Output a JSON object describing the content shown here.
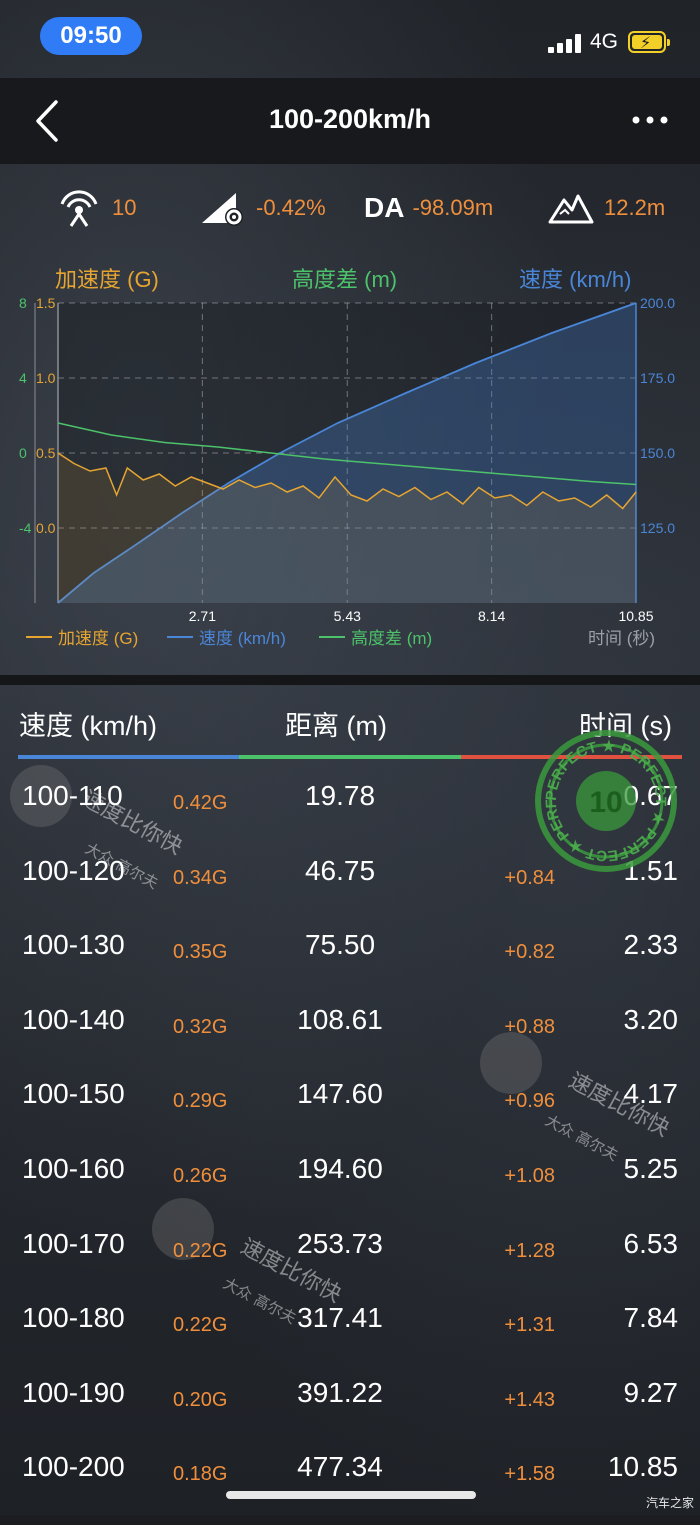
{
  "status_bar": {
    "time": "09:50",
    "network": "4G"
  },
  "nav": {
    "title": "100-200km/h"
  },
  "stats": {
    "satellites": "10",
    "slope": "-0.42%",
    "da_label": "DA",
    "da_value": "-98.09m",
    "altitude": "12.2m"
  },
  "chart_titles": {
    "accel": "加速度 (G)",
    "height": "高度差 (m)",
    "speed": "速度 (km/h)"
  },
  "legend": {
    "accel": "加速度 (G)",
    "speed": "速度 (km/h)",
    "height": "高度差 (m)",
    "time_axis": "时间 (秒)"
  },
  "chart_data": {
    "type": "line",
    "x_ticks": [
      "2.71",
      "5.43",
      "8.14",
      "10.85"
    ],
    "xlim": [
      0,
      10.85
    ],
    "left_ticks_height": [
      "8",
      "4",
      "0",
      "-4"
    ],
    "left_ticks_accel": [
      "1.5",
      "1.0",
      "0.5",
      "0.0"
    ],
    "right_ticks_speed": [
      "200.0",
      "175.0",
      "150.0",
      "125.0"
    ],
    "speed_ylim": [
      100,
      200
    ],
    "accel_ylim": [
      -0.5,
      1.5
    ],
    "height_ylim": [
      -12,
      8
    ],
    "series": [
      {
        "name": "速度 (km/h)",
        "axis": "right",
        "color": "#4a86d8",
        "x": [
          0,
          0.67,
          1.51,
          2.33,
          3.2,
          4.17,
          5.25,
          6.53,
          7.84,
          9.27,
          10.85
        ],
        "y": [
          100,
          110,
          120,
          130,
          140,
          150,
          160,
          170,
          180,
          190,
          200
        ]
      },
      {
        "name": "加速度 (G)",
        "axis": "left_accel",
        "color": "#e6a531",
        "x": [
          0,
          0.3,
          0.6,
          0.9,
          1.1,
          1.3,
          1.6,
          1.9,
          2.2,
          2.5,
          2.8,
          3.1,
          3.4,
          3.7,
          4.0,
          4.3,
          4.6,
          4.9,
          5.2,
          5.5,
          5.8,
          6.1,
          6.4,
          6.7,
          7.0,
          7.3,
          7.6,
          7.9,
          8.2,
          8.5,
          8.8,
          9.1,
          9.4,
          9.7,
          10.0,
          10.3,
          10.6,
          10.85
        ],
        "y": [
          0.5,
          0.43,
          0.38,
          0.4,
          0.22,
          0.4,
          0.32,
          0.36,
          0.28,
          0.34,
          0.3,
          0.26,
          0.32,
          0.27,
          0.3,
          0.24,
          0.28,
          0.2,
          0.34,
          0.22,
          0.18,
          0.26,
          0.21,
          0.27,
          0.19,
          0.24,
          0.16,
          0.27,
          0.2,
          0.22,
          0.15,
          0.24,
          0.18,
          0.2,
          0.14,
          0.22,
          0.13,
          0.24
        ]
      },
      {
        "name": "高度差 (m)",
        "axis": "left_height",
        "color": "#4cc26a",
        "x": [
          0,
          1,
          2,
          3,
          4,
          5,
          6,
          7,
          8,
          9,
          10,
          10.85
        ],
        "y": [
          0,
          -0.8,
          -1.3,
          -1.6,
          -2.0,
          -2.4,
          -2.7,
          -3.0,
          -3.3,
          -3.6,
          -3.9,
          -4.1
        ]
      }
    ]
  },
  "table": {
    "headers": {
      "speed": "速度 (km/h)",
      "distance": "距离 (m)",
      "time": "时间 (s)"
    },
    "rows": [
      {
        "speed": "100-110",
        "g": "0.42G",
        "distance": "19.78",
        "delta": "",
        "time": "0.67"
      },
      {
        "speed": "100-120",
        "g": "0.34G",
        "distance": "46.75",
        "delta": "+0.84",
        "time": "1.51"
      },
      {
        "speed": "100-130",
        "g": "0.35G",
        "distance": "75.50",
        "delta": "+0.82",
        "time": "2.33"
      },
      {
        "speed": "100-140",
        "g": "0.32G",
        "distance": "108.61",
        "delta": "+0.88",
        "time": "3.20"
      },
      {
        "speed": "100-150",
        "g": "0.29G",
        "distance": "147.60",
        "delta": "+0.96",
        "time": "4.17"
      },
      {
        "speed": "100-160",
        "g": "0.26G",
        "distance": "194.60",
        "delta": "+1.08",
        "time": "5.25"
      },
      {
        "speed": "100-170",
        "g": "0.22G",
        "distance": "253.73",
        "delta": "+1.28",
        "time": "6.53"
      },
      {
        "speed": "100-180",
        "g": "0.22G",
        "distance": "317.41",
        "delta": "+1.31",
        "time": "7.84"
      },
      {
        "speed": "100-190",
        "g": "0.20G",
        "distance": "391.22",
        "delta": "+1.43",
        "time": "9.27"
      },
      {
        "speed": "100-200",
        "g": "0.18G",
        "distance": "477.34",
        "delta": "+1.58",
        "time": "10.85"
      }
    ]
  },
  "watermarks": {
    "main": "速度比你快",
    "sub": "大众 高尔夫",
    "stamp_word": "PERFECT",
    "stamp_score": "10",
    "site": "汽车之家"
  },
  "colors": {
    "accent_orange": "#ef8f3c",
    "speed_blue": "#4a86d8",
    "height_green": "#4cc26a",
    "accel_yellow": "#e6a531",
    "divider_red": "#e0523f"
  }
}
